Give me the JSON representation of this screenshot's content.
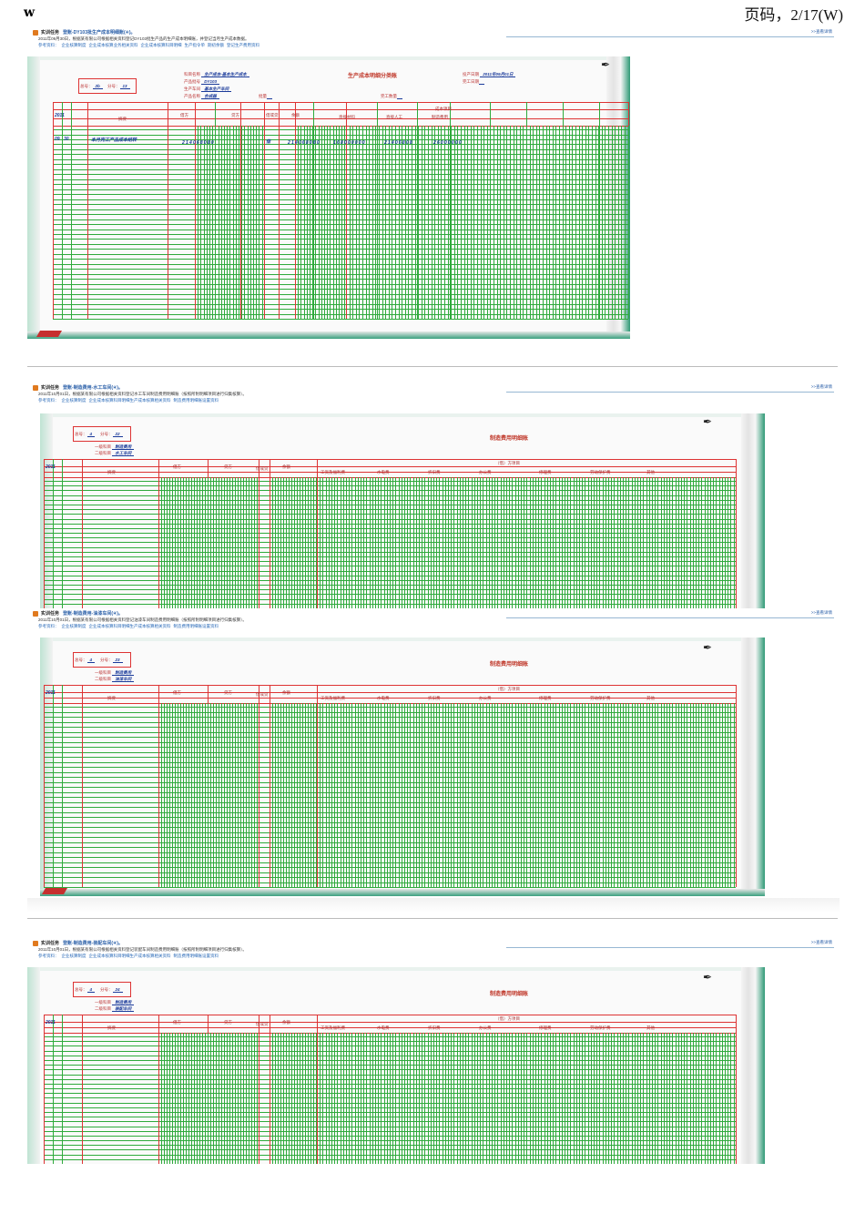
{
  "header": {
    "left": "w",
    "right": "页码，2/17(W)"
  },
  "panels": [
    {
      "task_label": "实训任务",
      "task_title": "登账-DY103批生产成本明细账(④)。",
      "description": "2011年09月30日，根据某有限公司根据相关资料登记DY103批生产品的生产成本明细账，并登记当月生产成本数据。",
      "refs": [
        "参考资料：",
        "企业核算制度",
        "企业成本核算业务相关资料",
        "企业成本核算科目明细",
        "生产指令单",
        "期初余额",
        "登记生产费用资料"
      ],
      "detail_link": ">>查看详情",
      "ledger": {
        "title": "生产成本明细分类账",
        "account_no": "总号：",
        "account_no_val": "2b",
        "sub_no": "分号：",
        "sub_no_val": "13",
        "fields": [
          {
            "label": "科目名称",
            "value": "生产成本-基本生产成本"
          },
          {
            "label": "产品批号",
            "value": "DY103"
          },
          {
            "label": "生产车间",
            "value": "基本生产车间"
          },
          {
            "label": "产品名称",
            "value": "合成器"
          }
        ],
        "right_fields": [
          {
            "label": "投产日期",
            "value": "2011年09月01日"
          },
          {
            "label": "完工日期",
            "value": ""
          },
          {
            "label": "批量",
            "value": ""
          },
          {
            "label": "完工数量",
            "value": ""
          }
        ],
        "year": "2011",
        "columns": [
          "月",
          "日",
          "凭证号数",
          "摘要",
          "借方",
          "贷方",
          "借或贷",
          "余额"
        ],
        "cost_heading": "成本项目",
        "cost_items": [
          "直接材料",
          "直接人工",
          "制造费用"
        ],
        "row1": {
          "month": "09",
          "day": "30",
          "summary": "本月完工产品成本结转",
          "debit": "214068080",
          "dc": "借",
          "balance": "214068080",
          "c1": "168000000",
          "c2": "21406808",
          "c3": "26000000"
        }
      }
    },
    {
      "task_label": "实训任务",
      "task_title": "登账-制造费用-水工车间(④)。",
      "description": "2011年10月01日，根据某有限公司根据相关资料登记水工车间制造费用明细账（按照所附明细项目进行归集核算）。",
      "refs": [
        "参考资料：",
        "企业核算制度",
        "企业成本核算科目明细生产成本核算相关资料",
        "制造费用明细账设置资料"
      ],
      "detail_link": ">>查看详情",
      "ledger": {
        "title": "制造费用明细账",
        "account_no": "总号：",
        "account_no_val": "4",
        "sub_no": "分号：",
        "sub_no_val": "22",
        "fields": [
          {
            "label": "一级科目",
            "value": "制造费用"
          },
          {
            "label": "二级科目",
            "value": "水工车间"
          }
        ],
        "year": "2011",
        "columns": [
          "月",
          "日",
          "凭证号数",
          "摘要",
          "借方",
          "贷方",
          "借或贷",
          "余额"
        ],
        "cost_heading": "（借）方项目",
        "cost_items": [
          "工资及福利费",
          "水电费",
          "折旧费",
          "办公费",
          "修理费",
          "劳动保护费",
          "其他"
        ]
      }
    },
    {
      "task_label": "实训任务",
      "task_title": "登账-制造费用-油漆车间(④)。",
      "description": "2011年10月01日，根据某有限公司根据相关资料登记油漆车间制造费用明细账（按照所附明细项目进行归集核算）。",
      "refs": [
        "参考资料：",
        "企业核算制度",
        "企业成本核算科目明细生产成本核算相关资料",
        "制造费用明细账设置资料"
      ],
      "detail_link": ">>查看详情",
      "ledger": {
        "title": "制造费用明细账",
        "account_no": "总号：",
        "account_no_val": "4",
        "sub_no": "分号：",
        "sub_no_val": "23",
        "fields": [
          {
            "label": "一级科目",
            "value": "制造费用"
          },
          {
            "label": "二级科目",
            "value": "油漆车间"
          }
        ],
        "year": "2011",
        "columns": [
          "月",
          "日",
          "凭证号数",
          "摘要",
          "借方",
          "贷方",
          "借或贷",
          "余额"
        ],
        "cost_heading": "（借）方项目",
        "cost_items": [
          "工资及福利费",
          "水电费",
          "折旧费",
          "办公费",
          "修理费",
          "劳动保护费",
          "其他"
        ]
      }
    },
    {
      "task_label": "实训任务",
      "task_title": "登账-制造费用-装配车间(④)。",
      "description": "2011年10月01日，根据某有限公司根据相关资料登记装配车间制造费用明细账（按照所附明细项目进行归集核算）。",
      "refs": [
        "参考资料：",
        "企业核算制度",
        "企业成本核算科目明细生产成本核算相关资料",
        "制造费用明细账设置资料"
      ],
      "detail_link": ">>查看详情",
      "ledger": {
        "title": "制造费用明细账",
        "account_no": "总号：",
        "account_no_val": "4",
        "sub_no": "分号：",
        "sub_no_val": "24",
        "fields": [
          {
            "label": "一级科目",
            "value": "制造费用"
          },
          {
            "label": "二级科目",
            "value": "装配车间"
          }
        ],
        "year": "2011",
        "columns": [
          "月",
          "日",
          "凭证号数",
          "摘要",
          "借方",
          "贷方",
          "借或贷",
          "余额"
        ],
        "cost_heading": "（借）方项目",
        "cost_items": [
          "工资及福利费",
          "水电费",
          "折旧费",
          "办公费",
          "修理费",
          "劳动保护费",
          "其他"
        ]
      }
    }
  ]
}
